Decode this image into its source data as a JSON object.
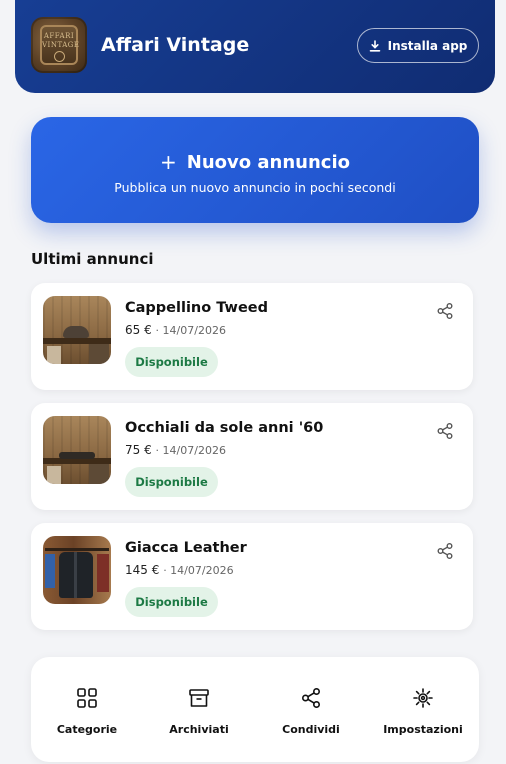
{
  "header": {
    "app_title": "Affari Vintage",
    "logo_text_line1": "AFFARI",
    "logo_text_line2": "VINTAGE",
    "install_label": "Installa app"
  },
  "new_listing": {
    "title": "Nuovo annuncio",
    "plus": "+",
    "subtitle": "Pubblica un nuovo annuncio in pochi secondi"
  },
  "section": {
    "title": "Ultimi annunci"
  },
  "listings": [
    {
      "title": "Cappellino Tweed",
      "price": "65 €",
      "date": "· 14/07/2026",
      "status": "Disponibile"
    },
    {
      "title": "Occhiali da sole anni '60",
      "price": "75 €",
      "date": "· 14/07/2026",
      "status": "Disponibile"
    },
    {
      "title": "Giacca Leather",
      "price": "145 €",
      "date": "· 14/07/2026",
      "status": "Disponibile"
    }
  ],
  "bottom_nav": {
    "items": [
      {
        "label": "Categorie",
        "icon": "grid-icon"
      },
      {
        "label": "Archiviati",
        "icon": "archive-icon"
      },
      {
        "label": "Condividi",
        "icon": "share-icon"
      },
      {
        "label": "Impostazioni",
        "icon": "gear-icon"
      }
    ]
  },
  "colors": {
    "header_bg": "#173e94",
    "accent": "#2a66e6",
    "badge_bg": "#e3f3e8",
    "badge_text": "#1d7a45",
    "page_bg": "#f3f4f7"
  }
}
